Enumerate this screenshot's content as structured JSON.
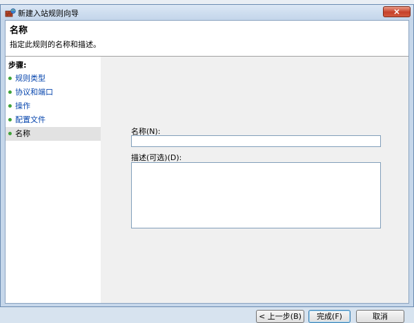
{
  "window": {
    "title": "新建入站规则向导",
    "close_label": "✕"
  },
  "header": {
    "title": "名称",
    "description": "指定此规则的名称和描述。"
  },
  "sidebar": {
    "steps_label": "步骤:",
    "items": [
      {
        "label": "规则类型"
      },
      {
        "label": "协议和端口"
      },
      {
        "label": "操作"
      },
      {
        "label": "配置文件"
      },
      {
        "label": "名称"
      }
    ]
  },
  "form": {
    "name_label": "名称(N):",
    "name_value": "",
    "desc_label": "描述(可选)(D):",
    "desc_value": ""
  },
  "buttons": {
    "back": "< 上一步(B)",
    "finish": "完成(F)",
    "cancel": "取消"
  },
  "colors": {
    "link": "#0645ad",
    "bullet": "#3fa23a",
    "selected_step": "#e2e2e2",
    "close_button": "#c6402a"
  }
}
